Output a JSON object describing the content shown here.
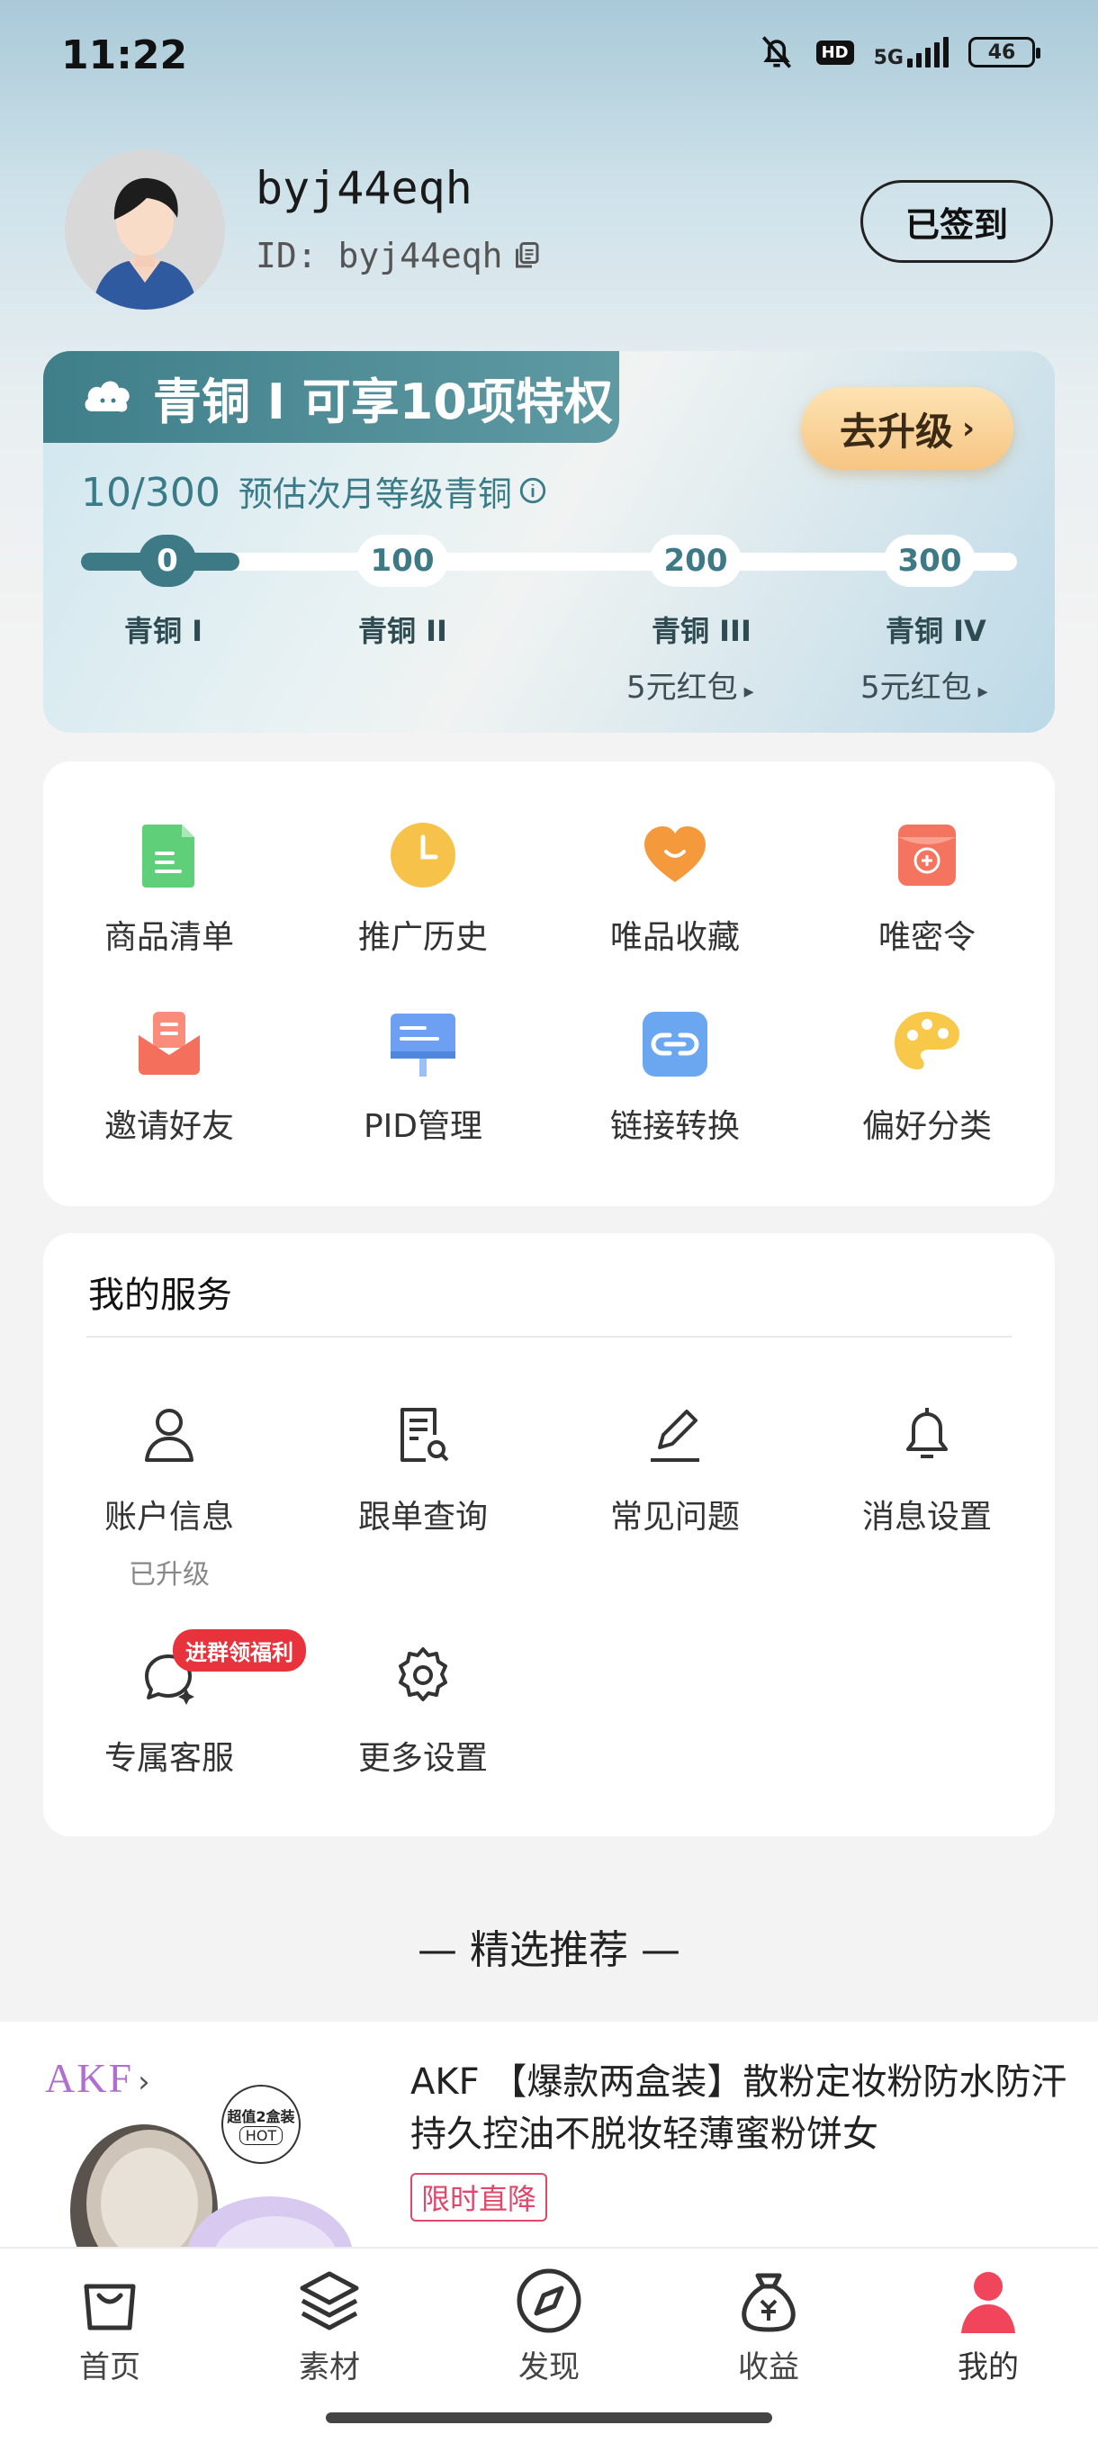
{
  "status_bar": {
    "time": "11:22",
    "hd": "HD",
    "network": "5G",
    "battery": "46"
  },
  "profile": {
    "username": "byj44eqh",
    "id_text": "ID: byj44eqh",
    "sign_button": "已签到"
  },
  "level": {
    "tag_title": "青铜 I  可享10项特权",
    "upgrade_button": "去升级",
    "progress_current": "10",
    "progress_total": "300",
    "progress_note": "预估次月等级青铜",
    "progress_value": 10,
    "nodes": [
      {
        "value": "0",
        "name": "青铜 I",
        "reward": ""
      },
      {
        "value": "100",
        "name": "青铜 II",
        "reward": ""
      },
      {
        "value": "200",
        "name": "青铜 III",
        "reward": "5元红包"
      },
      {
        "value": "300",
        "name": "青铜 IV",
        "reward": "5元红包"
      }
    ]
  },
  "tools": [
    {
      "label": "商品清单",
      "icon": "document-icon"
    },
    {
      "label": "推广历史",
      "icon": "clock-icon"
    },
    {
      "label": "唯品收藏",
      "icon": "heart-icon"
    },
    {
      "label": "唯密令",
      "icon": "red-envelope-icon"
    },
    {
      "label": "邀请好友",
      "icon": "mail-icon"
    },
    {
      "label": "PID管理",
      "icon": "billboard-icon"
    },
    {
      "label": "链接转换",
      "icon": "link-icon"
    },
    {
      "label": "偏好分类",
      "icon": "palette-icon"
    }
  ],
  "services": {
    "title": "我的服务",
    "items": [
      {
        "label": "账户信息",
        "sub": "已升级",
        "icon": "user-icon"
      },
      {
        "label": "跟单查询",
        "sub": "",
        "icon": "doc-search-icon"
      },
      {
        "label": "常见问题",
        "sub": "",
        "icon": "pencil-icon"
      },
      {
        "label": "消息设置",
        "sub": "",
        "icon": "bell-icon"
      },
      {
        "label": "专属客服",
        "sub": "",
        "icon": "chat-icon"
      },
      {
        "label": "更多设置",
        "sub": "",
        "icon": "gear-icon"
      }
    ],
    "badge": "进群领福利"
  },
  "recommend": {
    "title": "— 精选推荐 —"
  },
  "product": {
    "brand": "AKF",
    "image_badge": "超值2盒装",
    "image_badge_sub": "HOT",
    "title": "AKF  【爆款两盒装】散粉定妆粉防水防汗持久控油不脱妆轻薄蜜粉饼女",
    "tag": "限时直降"
  },
  "tabbar": [
    {
      "label": "首页",
      "icon": "bag-icon"
    },
    {
      "label": "素材",
      "icon": "layers-icon"
    },
    {
      "label": "发现",
      "icon": "compass-icon"
    },
    {
      "label": "收益",
      "icon": "money-bag-icon"
    },
    {
      "label": "我的",
      "icon": "person-icon",
      "active": true
    }
  ],
  "colors": {
    "accent": "#3d7a85",
    "upgrade": "#f6c583",
    "badge": "#e8323c",
    "active_tab": "#f0455a"
  }
}
